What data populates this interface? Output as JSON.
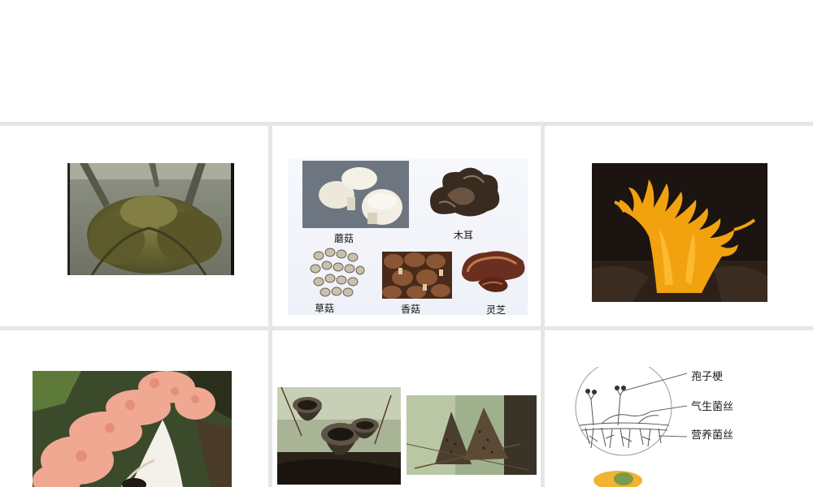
{
  "slide": {
    "mushroom_collage": {
      "labels": {
        "white_mushroom": "蘑菇",
        "wood_ear": "木耳",
        "straw_mushroom": "草菇",
        "shiitake": "香菇",
        "reishi": "灵芝"
      }
    },
    "mycelium_diagram": {
      "labels": {
        "sporangiophore": "孢子梗",
        "aerial_hyphae": "气生菌丝",
        "vegetative_hyphae": "营养菌丝"
      }
    }
  }
}
